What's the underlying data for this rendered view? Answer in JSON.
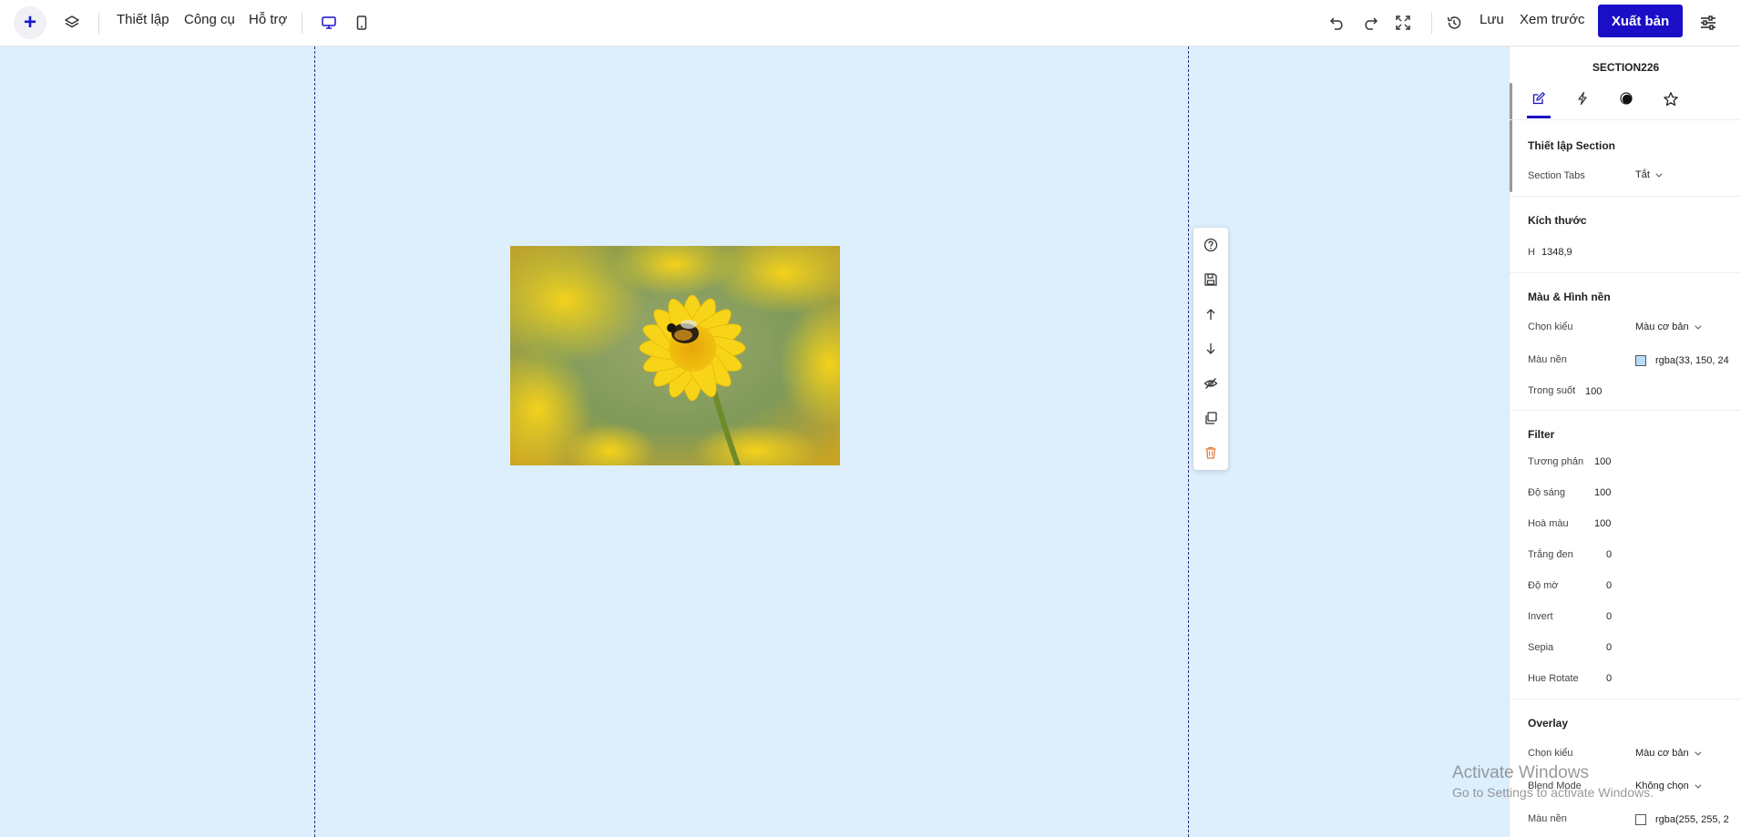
{
  "topbar": {
    "add_label": "+",
    "menu": [
      "Thiết lập",
      "Công cụ",
      "Hỗ trợ"
    ],
    "save_label": "Lưu",
    "preview_label": "Xem trước",
    "publish_label": "Xuất bản"
  },
  "canvas": {
    "background": "#ddeefd",
    "image_alt": "Yellow flower with bee"
  },
  "panel": {
    "title": "SECTION226",
    "tabs": [
      "edit-icon",
      "lightning-icon",
      "contrast-icon",
      "star-icon"
    ],
    "section_settings": {
      "heading": "Thiết lập Section",
      "tabs_label": "Section Tabs",
      "tabs_value": "Tắt"
    },
    "size": {
      "heading": "Kích thước",
      "h_label": "H",
      "h_value": "1348,9"
    },
    "background": {
      "heading": "Màu & Hình nền",
      "style_label": "Chọn kiểu",
      "style_value": "Màu cơ bản",
      "color_label": "Màu nền",
      "color_value": "rgba(33, 150, 24",
      "color_hex": "#b7dcf7",
      "opacity_label": "Trong suốt",
      "opacity_value": "100"
    },
    "filter": {
      "heading": "Filter",
      "items": [
        {
          "label": "Tương phản",
          "value": "100"
        },
        {
          "label": "Độ sáng",
          "value": "100"
        },
        {
          "label": "Hoà màu",
          "value": "100"
        },
        {
          "label": "Trắng đen",
          "value": "0"
        },
        {
          "label": "Độ mờ",
          "value": "0"
        },
        {
          "label": "Invert",
          "value": "0"
        },
        {
          "label": "Sepia",
          "value": "0"
        },
        {
          "label": "Hue Rotate",
          "value": "0"
        }
      ]
    },
    "overlay": {
      "heading": "Overlay",
      "style_label": "Chọn kiểu",
      "style_value": "Màu cơ bản",
      "blend_label": "Blend Mode",
      "blend_value": "Không chọn",
      "color_label": "Màu nền",
      "color_value": "rgba(255, 255, 2",
      "color_hex": "#ffffff"
    }
  },
  "watermark": {
    "line1": "Activate Windows",
    "line2": "Go to Settings to activate Windows."
  },
  "colors": {
    "accent": "#1a0fc7",
    "canvas_bg": "#ddeefd",
    "delete": "#e07a3a"
  }
}
